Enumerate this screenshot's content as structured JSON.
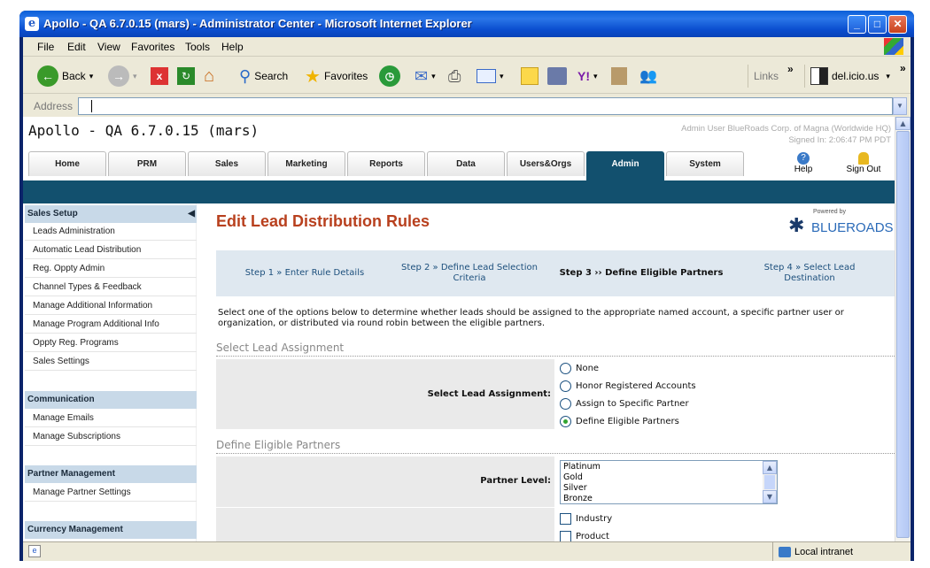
{
  "window": {
    "title": "Apollo - QA 6.7.0.15 (mars) - Administrator Center - Microsoft Internet Explorer",
    "buttons": [
      "_",
      "□",
      "✕"
    ]
  },
  "menu": [
    "File",
    "Edit",
    "View",
    "Favorites",
    "Tools",
    "Help"
  ],
  "toolbar": {
    "back": "Back",
    "search": "Search",
    "favorites": "Favorites",
    "links": "Links",
    "delicious": "del.icio.us"
  },
  "address": {
    "label": "Address",
    "value": ""
  },
  "app": {
    "title": "Apollo - QA 6.7.0.15 (mars)",
    "user_line1": "Admin User BlueRoads Corp. of Magna (Worldwide HQ)",
    "user_line2": "Signed In: 2:06:47 PM PDT",
    "tabs": [
      "Home",
      "PRM",
      "Sales",
      "Marketing",
      "Reports",
      "Data",
      "Users&Orgs",
      "Admin",
      "System"
    ],
    "active_tab": "Admin",
    "help": "Help",
    "signout": "Sign Out"
  },
  "sidebar": {
    "sales_setup": {
      "header": "Sales Setup",
      "items": [
        "Leads Administration",
        "Automatic Lead Distribution",
        "Reg. Oppty Admin",
        "Channel Types & Feedback",
        "Manage Additional Information",
        "Manage Program Additional Info",
        "Oppty Reg. Programs",
        "Sales Settings"
      ]
    },
    "communication": {
      "header": "Communication",
      "items": [
        "Manage Emails",
        "Manage Subscriptions"
      ]
    },
    "partner_management": {
      "header": "Partner Management",
      "items": [
        "Manage Partner Settings"
      ]
    },
    "currency_management": {
      "header": "Currency Management"
    }
  },
  "main": {
    "title": "Edit Lead Distribution Rules",
    "logo_powered": "Powered by",
    "logo_brand": "BLUEROADS",
    "steps": [
      "Step 1 » Enter Rule Details",
      "Step 2 » Define Lead Selection Criteria",
      "Step 3 ›› Define Eligible Partners",
      "Step 4 » Select Lead Destination"
    ],
    "intro": "Select one of the options below to determine whether leads should be assigned to the appropriate named account, a specific partner user or organization, or distributed via round robin between the eligible partners.",
    "section1": "Select Lead Assignment",
    "assignment_label": "Select Lead Assignment:",
    "assignment_options": [
      "None",
      "Honor Registered Accounts",
      "Assign to Specific Partner",
      "Define Eligible Partners"
    ],
    "assignment_selected": "Define Eligible Partners",
    "section2": "Define Eligible Partners",
    "partner_level_label": "Partner Level:",
    "partner_levels": [
      "Platinum",
      "Gold",
      "Silver",
      "Bronze"
    ],
    "criteria_options": [
      "Industry",
      "Product"
    ]
  },
  "status": {
    "zone": "Local intranet"
  }
}
